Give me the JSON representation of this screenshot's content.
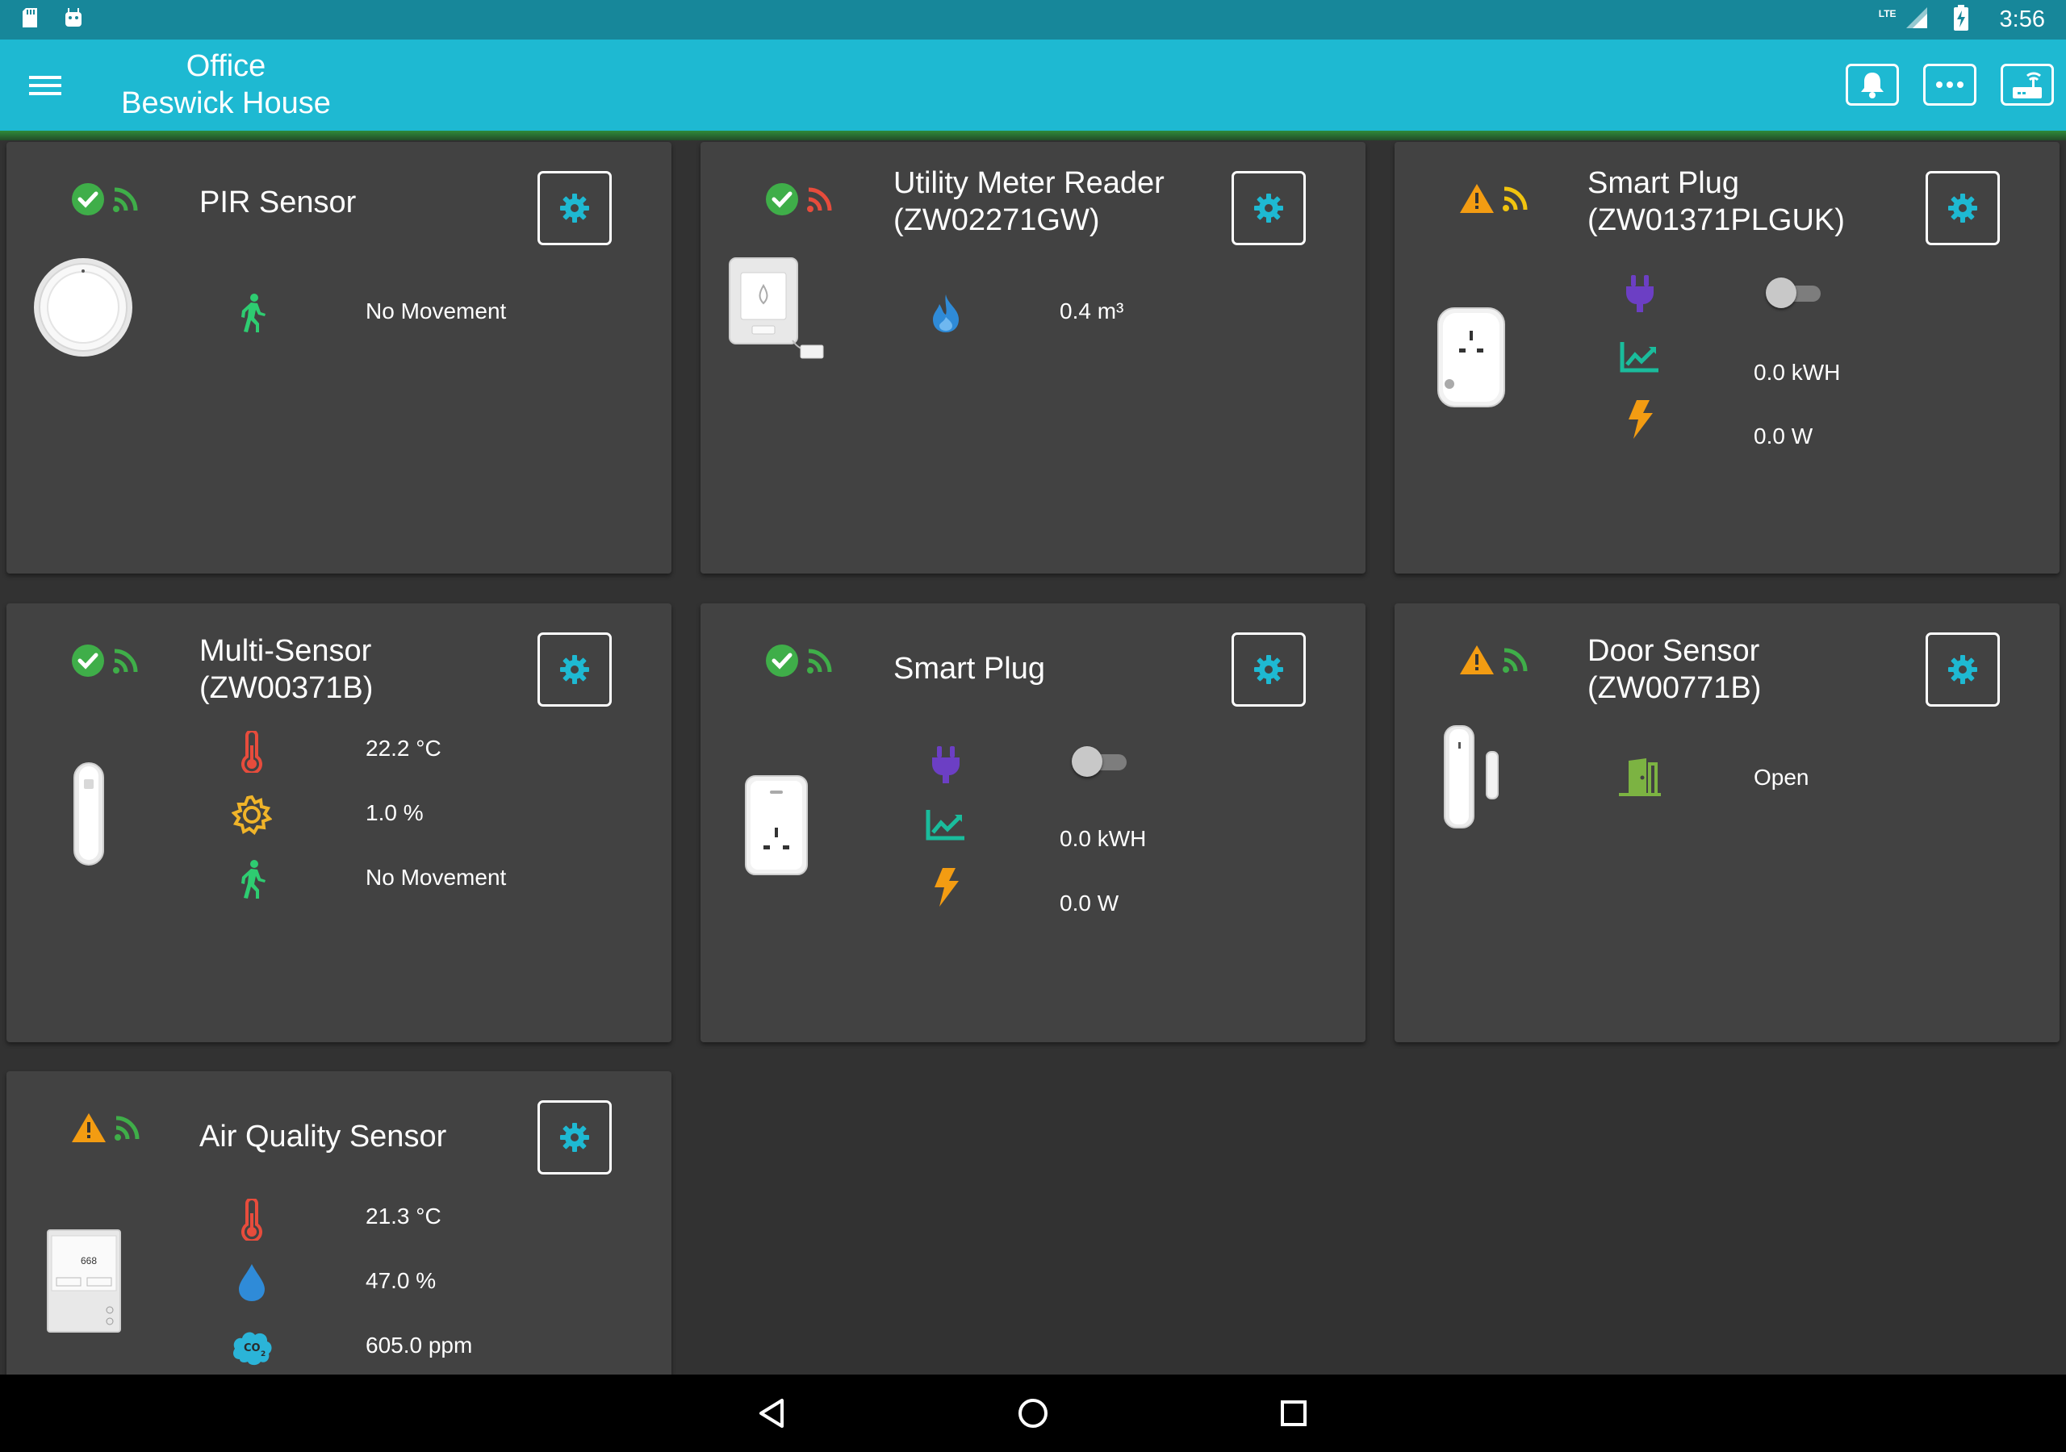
{
  "status_bar": {
    "time": "3:56",
    "network": "LTE",
    "icons": [
      "sd-card-icon",
      "android-icon",
      "signal-icon",
      "battery-charging-icon"
    ]
  },
  "app_bar": {
    "title": "Office",
    "subtitle": "Beswick House",
    "actions": [
      "bell-icon",
      "more-horizontal-icon",
      "router-icon"
    ]
  },
  "colors": {
    "app_bar": "#1eb9d2",
    "status_bar": "#17879a",
    "card": "#424242",
    "background": "#323232",
    "ok_green": "#3fae49",
    "warning_orange": "#f39c12",
    "signal_red": "#e74c3c",
    "signal_yellow": "#f1c40f",
    "settings_cyan": "#1eb9d2"
  },
  "cards": {
    "pir": {
      "title": "PIR Sensor",
      "status": "ok",
      "signal": "green",
      "readings": [
        {
          "icon": "walking-person-icon",
          "value": "No Movement"
        }
      ]
    },
    "utility": {
      "title": "Utility Meter Reader\n(ZW02271GW)",
      "status": "ok",
      "signal": "red",
      "readings": [
        {
          "icon": "flame-icon",
          "value": "0.4 m³"
        }
      ]
    },
    "plug1": {
      "title": "Smart Plug\n(ZW01371PLGUK)",
      "status": "warning",
      "signal": "yellow",
      "switch_on": false,
      "readings": [
        {
          "icon": "plug-icon",
          "value": ""
        },
        {
          "icon": "chart-line-icon",
          "value": "0.0 kWH"
        },
        {
          "icon": "lightning-icon",
          "value": "0.0 W"
        }
      ]
    },
    "multi": {
      "title": "Multi-Sensor\n(ZW00371B)",
      "status": "ok",
      "signal": "green",
      "readings": [
        {
          "icon": "thermometer-icon",
          "value": "22.2 °C"
        },
        {
          "icon": "brightness-gear-icon",
          "value": "1.0 %"
        },
        {
          "icon": "walking-person-icon",
          "value": "No Movement"
        }
      ]
    },
    "plug2": {
      "title": "Smart Plug",
      "status": "ok",
      "signal": "green",
      "switch_on": false,
      "readings": [
        {
          "icon": "plug-icon",
          "value": ""
        },
        {
          "icon": "chart-line-icon",
          "value": "0.0 kWH"
        },
        {
          "icon": "lightning-icon",
          "value": "0.0 W"
        }
      ]
    },
    "door": {
      "title": "Door Sensor\n(ZW00771B)",
      "status": "warning",
      "signal": "green",
      "readings": [
        {
          "icon": "door-open-icon",
          "value": "Open"
        }
      ]
    },
    "air": {
      "title": "Air Quality Sensor",
      "status": "warning",
      "signal": "green",
      "device_display": "668",
      "readings": [
        {
          "icon": "thermometer-icon",
          "value": "21.3 °C"
        },
        {
          "icon": "water-drop-icon",
          "value": "47.0 %"
        },
        {
          "icon": "co2-cloud-icon",
          "value": "605.0 ppm"
        }
      ]
    }
  },
  "nav_bar": {
    "buttons": [
      "back-icon",
      "home-icon",
      "recents-icon"
    ]
  }
}
